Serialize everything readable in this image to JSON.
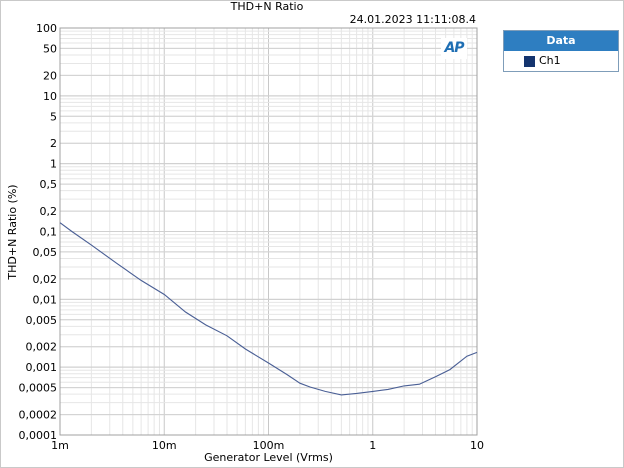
{
  "chart_data": {
    "type": "line",
    "title": "THD+N Ratio",
    "timestamp": "24.01.2023 11:11:08.4",
    "xlabel": "Generator Level (Vrms)",
    "ylabel": "THD+N Ratio (%)",
    "xscale": "log",
    "yscale": "log",
    "xlim": [
      0.001,
      10
    ],
    "ylim": [
      0.0001,
      100
    ],
    "grid": true,
    "legend": {
      "title": "Data",
      "placement": "right"
    },
    "x_ticks": [
      {
        "value": 0.001,
        "label": "1m"
      },
      {
        "value": 0.01,
        "label": "10m"
      },
      {
        "value": 0.1,
        "label": "100m"
      },
      {
        "value": 1,
        "label": "1"
      },
      {
        "value": 10,
        "label": "10"
      }
    ],
    "y_ticks": [
      {
        "value": 100,
        "label": "100"
      },
      {
        "value": 50,
        "label": "50"
      },
      {
        "value": 20,
        "label": "20"
      },
      {
        "value": 10,
        "label": "10"
      },
      {
        "value": 5,
        "label": "5"
      },
      {
        "value": 2,
        "label": "2"
      },
      {
        "value": 1,
        "label": "1"
      },
      {
        "value": 0.5,
        "label": "0,5"
      },
      {
        "value": 0.2,
        "label": "0,2"
      },
      {
        "value": 0.1,
        "label": "0,1"
      },
      {
        "value": 0.05,
        "label": "0,05"
      },
      {
        "value": 0.02,
        "label": "0,02"
      },
      {
        "value": 0.01,
        "label": "0,01"
      },
      {
        "value": 0.005,
        "label": "0,005"
      },
      {
        "value": 0.002,
        "label": "0,002"
      },
      {
        "value": 0.001,
        "label": "0,001"
      },
      {
        "value": 0.0005,
        "label": "0,0005"
      },
      {
        "value": 0.0002,
        "label": "0,0002"
      },
      {
        "value": 0.0001,
        "label": "0,0001"
      }
    ],
    "series": [
      {
        "name": "Ch1",
        "color": "#4a5f95",
        "x": [
          0.001,
          0.0013,
          0.002,
          0.0035,
          0.006,
          0.01,
          0.016,
          0.025,
          0.04,
          0.06,
          0.1,
          0.15,
          0.2,
          0.25,
          0.35,
          0.5,
          0.7,
          1.0,
          1.4,
          2.0,
          2.8,
          4.0,
          5.5,
          8.0,
          10.0
        ],
        "y": [
          0.135,
          0.1,
          0.063,
          0.034,
          0.019,
          0.0118,
          0.0065,
          0.0042,
          0.0029,
          0.00185,
          0.00115,
          0.00078,
          0.00058,
          0.00051,
          0.00044,
          0.00039,
          0.00041,
          0.00044,
          0.00047,
          0.00053,
          0.00056,
          0.00072,
          0.00092,
          0.00145,
          0.00165
        ]
      }
    ]
  },
  "logo": {
    "text": "AP",
    "color": "#1f6fb4"
  },
  "legend": {
    "header": "Data",
    "items": [
      {
        "label": "Ch1",
        "color": "#14346e"
      }
    ]
  }
}
